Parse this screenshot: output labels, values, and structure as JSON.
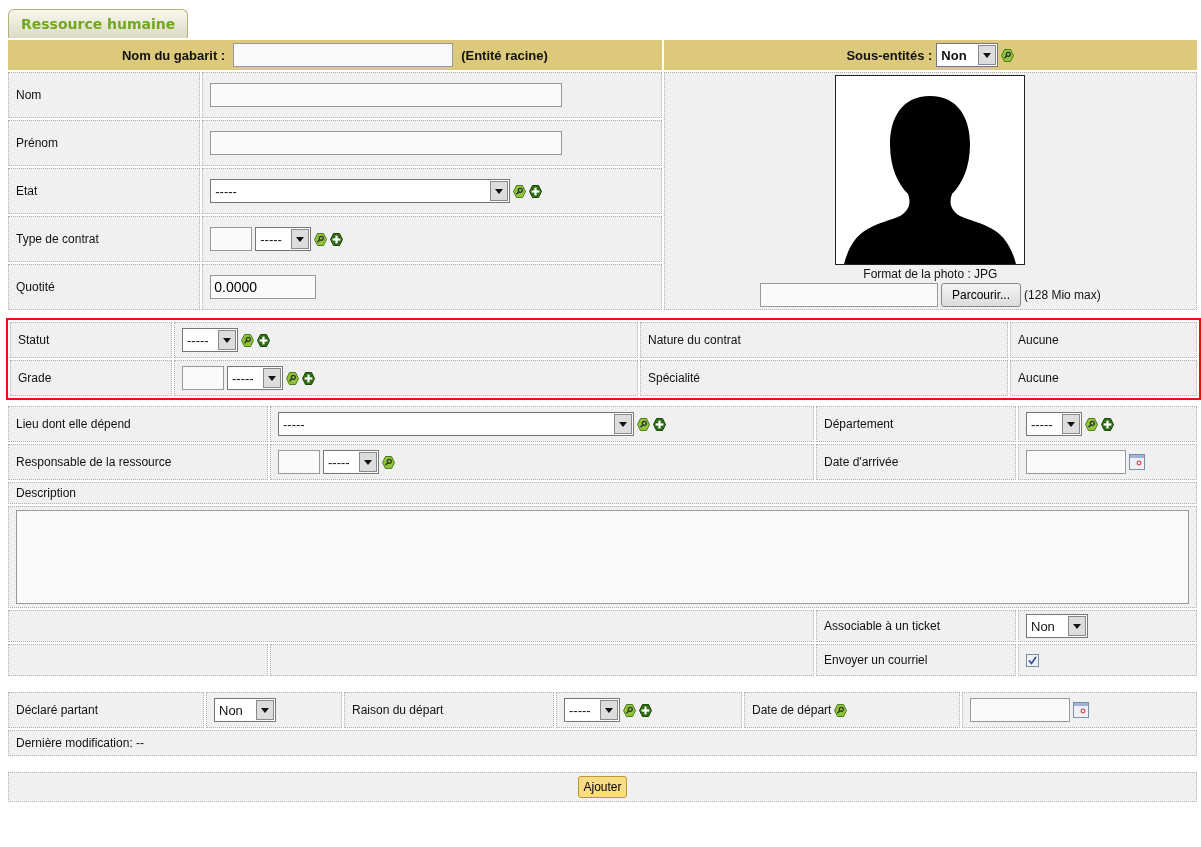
{
  "tab": {
    "label": "Ressource humaine",
    "selected": true
  },
  "header": {
    "template_label": "Nom du gabarit :",
    "root_note": "(Entité racine)",
    "subentities_label": "Sous-entités :",
    "subentities": {
      "kind": "select",
      "value": "Non",
      "actions": [
        {
          "kind": "search"
        }
      ]
    }
  },
  "fields": [
    {
      "label": "Nom",
      "control": {
        "kind": "text"
      }
    },
    {
      "label": "Prénom",
      "control": {
        "kind": "text"
      }
    },
    {
      "label": "Etat",
      "control": {
        "kind": "select",
        "value": "-----",
        "actions": [
          {
            "kind": "search"
          },
          {
            "kind": "add"
          }
        ]
      }
    },
    {
      "label": "Type de contrat",
      "control": {
        "kind": "filter_select",
        "value": "-----",
        "actions": [
          {
            "kind": "search"
          },
          {
            "kind": "add"
          }
        ]
      }
    },
    {
      "label": "Quotité",
      "control": {
        "kind": "text",
        "value": "0.0000"
      }
    }
  ],
  "photo": {
    "format_note": "Format de la photo : JPG",
    "browse_button": "Parcourir...",
    "size_note": "(128 Mio max)"
  },
  "career": {
    "highlighted": true,
    "rows": [
      {
        "label": "Statut",
        "control": {
          "kind": "select",
          "value": "-----",
          "actions": [
            {
              "kind": "search"
            },
            {
              "kind": "add"
            }
          ]
        },
        "info_label": "Nature du contrat",
        "info_value": "Aucune"
      },
      {
        "label": "Grade",
        "control": {
          "kind": "filter_select",
          "value": "-----",
          "actions": [
            {
              "kind": "search"
            },
            {
              "kind": "add"
            }
          ]
        },
        "info_label": "Spécialité",
        "info_value": "Aucune"
      }
    ]
  },
  "assignment": {
    "rows": [
      {
        "label": "Lieu dont elle dépend",
        "control": {
          "kind": "select",
          "value": "-----",
          "actions": [
            {
              "kind": "search"
            },
            {
              "kind": "add"
            }
          ]
        },
        "side_label": "Département",
        "side_control": {
          "kind": "select",
          "value": "-----",
          "actions": [
            {
              "kind": "search"
            },
            {
              "kind": "add"
            }
          ]
        }
      },
      {
        "label": "Responsable de la ressource",
        "control": {
          "kind": "filter_select",
          "value": "-----",
          "actions": [
            {
              "kind": "search"
            }
          ]
        },
        "side_label": "Date d'arrivée",
        "side_control": {
          "kind": "date"
        }
      }
    ],
    "description_label": "Description",
    "options": [
      {
        "label": "Associable à un ticket",
        "control": {
          "kind": "select",
          "value": "Non"
        }
      },
      {
        "label": "Envoyer un courriel",
        "control": {
          "kind": "checkbox",
          "checked": true
        }
      }
    ]
  },
  "departure": {
    "declared_label": "Déclaré partant",
    "declared": {
      "kind": "select",
      "value": "Non"
    },
    "reason_label": "Raison du départ",
    "reason": {
      "kind": "select",
      "value": "-----",
      "actions": [
        {
          "kind": "search"
        },
        {
          "kind": "add"
        }
      ]
    },
    "date_label": "Date de départ",
    "date_label_actions": [
      {
        "kind": "search"
      }
    ],
    "date": {
      "kind": "date"
    },
    "last_modified": "Dernière modification: --"
  },
  "submit_button": "Ajouter"
}
